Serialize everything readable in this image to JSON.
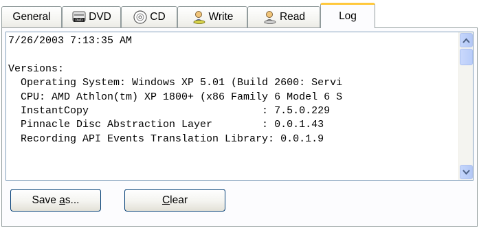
{
  "tabs": [
    {
      "label": "General",
      "icon": "none",
      "active": false
    },
    {
      "label": "DVD",
      "icon": "dvd-drive-icon",
      "active": false
    },
    {
      "label": "CD",
      "icon": "cd-disc-icon",
      "active": false
    },
    {
      "label": "Write",
      "icon": "write-person-icon",
      "active": false
    },
    {
      "label": "Read",
      "icon": "read-person-icon",
      "active": false
    },
    {
      "label": "Log",
      "icon": "none",
      "active": true
    }
  ],
  "log": {
    "lines": [
      "7/26/2003 7:13:35 AM",
      "",
      "Versions:",
      "  Operating System: Windows XP 5.01 (Build 2600: Servi",
      "  CPU: AMD Athlon(tm) XP 1800+ (x86 Family 6 Model 6 S",
      "  InstantCopy                            : 7.5.0.229",
      "  Pinnacle Disc Abstraction Layer        : 0.0.1.43",
      "  Recording API Events Translation Library: 0.0.1.9"
    ]
  },
  "buttons": {
    "save_as": {
      "before": "Save ",
      "mnemonic": "a",
      "after": "s..."
    },
    "clear": {
      "before": "",
      "mnemonic": "C",
      "after": "lear"
    }
  },
  "colors": {
    "active_tab_accent": "#ffc83c",
    "border": "#919b9c",
    "scrollbar": "#c5d6fc"
  }
}
